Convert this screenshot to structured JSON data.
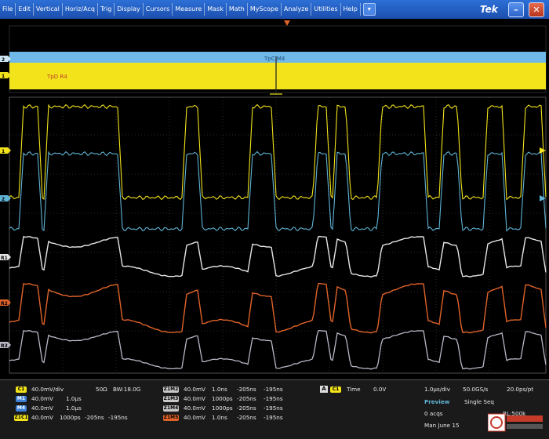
{
  "menubar": {
    "items": [
      "File",
      "Edit",
      "Vertical",
      "Horiz/Acq",
      "Trig",
      "Display",
      "Cursors",
      "Measure",
      "Mask",
      "Math",
      "MyScope",
      "Analyze",
      "Utilities",
      "Help"
    ],
    "dropdown_glyph": "▾",
    "brand": "Tek",
    "minimize_glyph": "–",
    "close_glyph": "✕"
  },
  "waveform": {
    "bus_label_top": "TpC M4",
    "bus_label_yellow": "TpD R4",
    "channel_markers": [
      "2",
      "1",
      "1",
      "2",
      "R1",
      "R2",
      "R3"
    ]
  },
  "status": {
    "c1": {
      "badge": "C1",
      "scale": "40.0mV/div",
      "impedance": "50Ω",
      "bw": "BW:18.0G"
    },
    "m1": {
      "badge": "M1",
      "scale": "40.0mV",
      "time": "1.0µs"
    },
    "m4": {
      "badge": "M4",
      "scale": "40.0mV",
      "time": "1.0µs"
    },
    "zoom_c1": {
      "badge": "Z1C1",
      "scale": "40.0mV",
      "time": "1000ps",
      "pos": "-205ns",
      "delay": "-195ns"
    },
    "z_rows": [
      {
        "badge": "Z1M2",
        "scale": "40.0mV",
        "time": "1.0ns",
        "pos": "-205ns",
        "delay": "-195ns"
      },
      {
        "badge": "Z1M3",
        "scale": "40.0mV",
        "time": "1000ps",
        "pos": "-205ns",
        "delay": "-195ns"
      },
      {
        "badge": "Z1M4",
        "scale": "40.0mV",
        "time": "1000ps",
        "pos": "-205ns",
        "delay": "-195ns"
      },
      {
        "badge": "Z1M5",
        "scale": "40.0mV",
        "time": "1.0ns",
        "pos": "-205ns",
        "delay": "-195ns"
      }
    ],
    "trigger": {
      "mode_button": "A",
      "badge": "C1",
      "label": "Time",
      "level": "0.0V"
    },
    "horiz": {
      "scale": "1.0µs/div",
      "rate": "50.0GS/s",
      "res": "20.0ps/pt"
    },
    "acq": {
      "state": "Preview",
      "mode": "Single Seq",
      "count": "0 acqs",
      "rl": "RL:500k"
    },
    "date": "Man   June 15"
  },
  "colors": {
    "yellow": "#f2e31b",
    "cyan": "#5fb4d6",
    "white": "#e6e6e6",
    "orange": "#e0632a",
    "gray": "#b8b8c8",
    "math_badge": "#3b7fd6",
    "zoom_badge": "#c8c8c8",
    "grid": "#555555"
  }
}
